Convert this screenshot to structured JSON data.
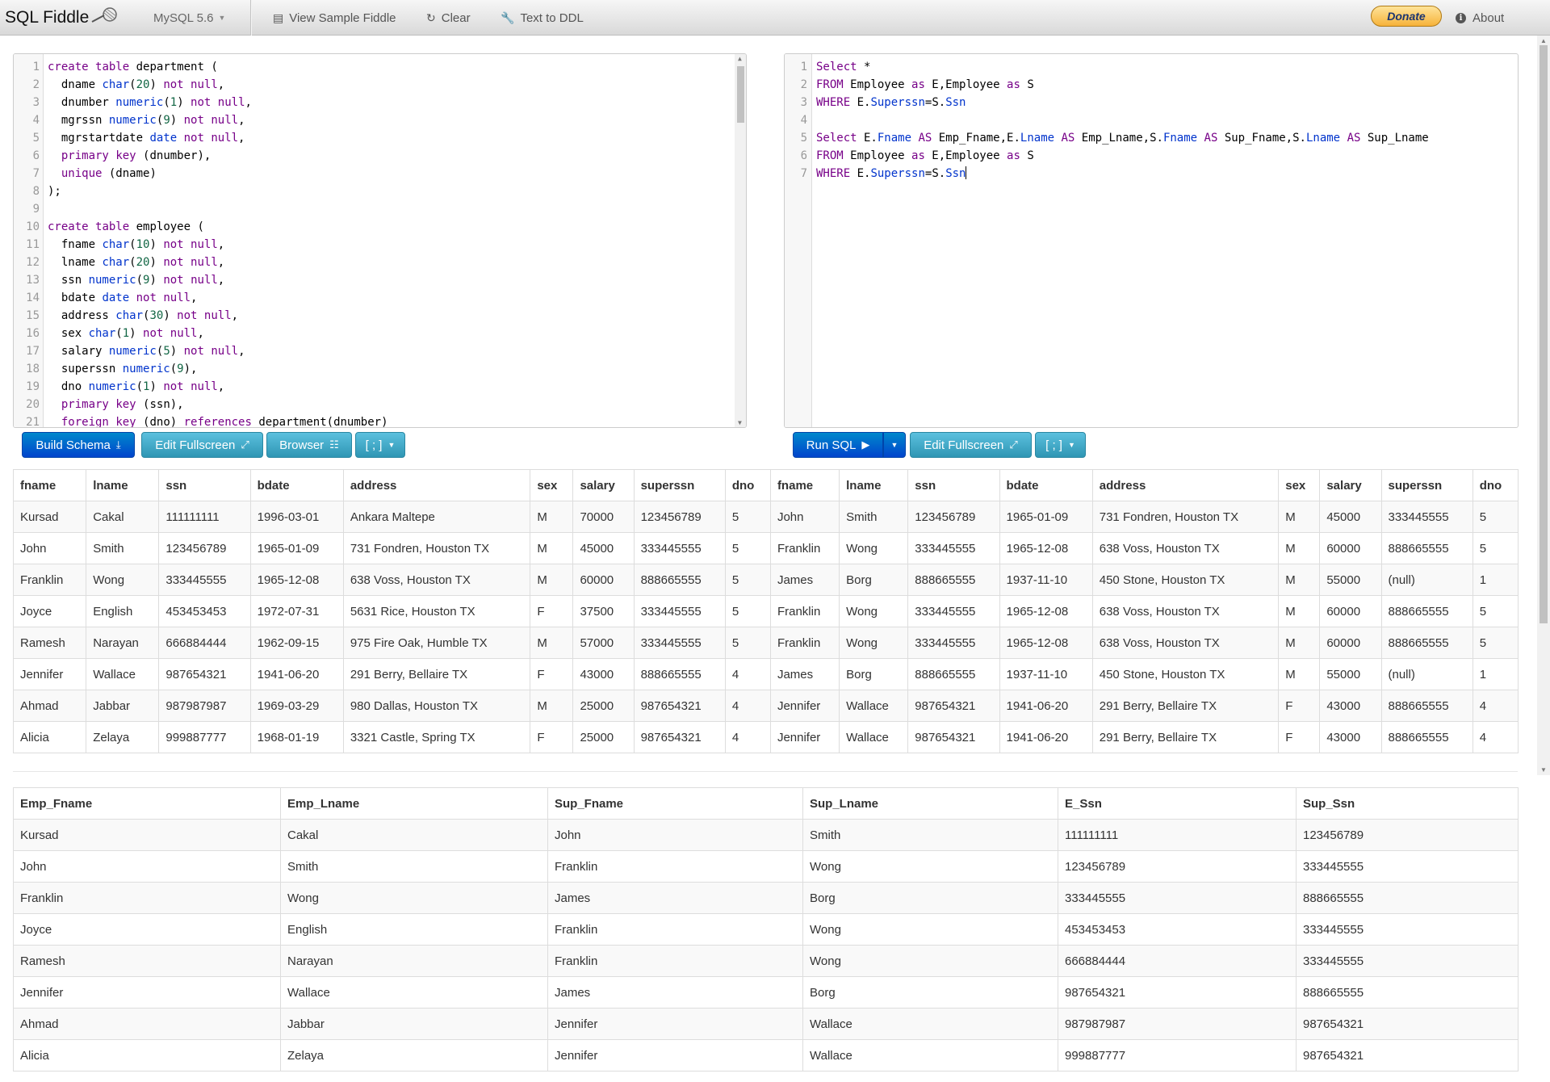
{
  "navbar": {
    "brand": "SQL Fiddle",
    "db_version": "MySQL 5.6",
    "view_sample": "View Sample Fiddle",
    "clear": "Clear",
    "text_to_ddl": "Text to DDL",
    "donate": "Donate",
    "about": "About"
  },
  "schema_panel": {
    "build_label": "Build Schema",
    "edit_fullscreen_label": "Edit Fullscreen",
    "browser_label": "Browser",
    "terminator_label": "[ ; ]"
  },
  "query_panel": {
    "run_label": "Run SQL",
    "edit_fullscreen_label": "Edit Fullscreen",
    "terminator_label": "[ ; ]"
  },
  "schema_code": [
    "create table department (",
    "  dname char(20) not null,",
    "  dnumber numeric(1) not null,",
    "  mgrssn numeric(9) not null,",
    "  mgrstartdate date not null,",
    "  primary key (dnumber),",
    "  unique (dname)",
    ");",
    "",
    "create table employee (",
    "  fname char(10) not null,",
    "  lname char(20) not null,",
    "  ssn numeric(9) not null,",
    "  bdate date not null,",
    "  address char(30) not null,",
    "  sex char(1) not null,",
    "  salary numeric(5) not null,",
    "  superssn numeric(9),",
    "  dno numeric(1) not null,",
    "  primary key (ssn),",
    "  foreign key (dno) references department(dnumber)"
  ],
  "query_code": [
    "Select *",
    "FROM Employee as E,Employee as S",
    "WHERE E.Superssn=S.Ssn",
    "",
    "Select E.Fname AS Emp_Fname,E.Lname AS Emp_Lname,S.Fname AS Sup_Fname,S.Lname AS Sup_Lname",
    "FROM Employee as E,Employee as S",
    "WHERE E.Superssn=S.Ssn"
  ],
  "result1": {
    "columns": [
      "fname",
      "lname",
      "ssn",
      "bdate",
      "address",
      "sex",
      "salary",
      "superssn",
      "dno",
      "fname",
      "lname",
      "ssn",
      "bdate",
      "address",
      "sex",
      "salary",
      "superssn",
      "dno"
    ],
    "rows": [
      [
        "Kursad",
        "Cakal",
        "111111111",
        "1996-03-01",
        "Ankara Maltepe",
        "M",
        "70000",
        "123456789",
        "5",
        "John",
        "Smith",
        "123456789",
        "1965-01-09",
        "731 Fondren, Houston TX",
        "M",
        "45000",
        "333445555",
        "5"
      ],
      [
        "John",
        "Smith",
        "123456789",
        "1965-01-09",
        "731 Fondren, Houston TX",
        "M",
        "45000",
        "333445555",
        "5",
        "Franklin",
        "Wong",
        "333445555",
        "1965-12-08",
        "638 Voss, Houston TX",
        "M",
        "60000",
        "888665555",
        "5"
      ],
      [
        "Franklin",
        "Wong",
        "333445555",
        "1965-12-08",
        "638 Voss, Houston TX",
        "M",
        "60000",
        "888665555",
        "5",
        "James",
        "Borg",
        "888665555",
        "1937-11-10",
        "450 Stone, Houston TX",
        "M",
        "55000",
        "(null)",
        "1"
      ],
      [
        "Joyce",
        "English",
        "453453453",
        "1972-07-31",
        "5631 Rice, Houston TX",
        "F",
        "37500",
        "333445555",
        "5",
        "Franklin",
        "Wong",
        "333445555",
        "1965-12-08",
        "638 Voss, Houston TX",
        "M",
        "60000",
        "888665555",
        "5"
      ],
      [
        "Ramesh",
        "Narayan",
        "666884444",
        "1962-09-15",
        "975 Fire Oak, Humble TX",
        "M",
        "57000",
        "333445555",
        "5",
        "Franklin",
        "Wong",
        "333445555",
        "1965-12-08",
        "638 Voss, Houston TX",
        "M",
        "60000",
        "888665555",
        "5"
      ],
      [
        "Jennifer",
        "Wallace",
        "987654321",
        "1941-06-20",
        "291 Berry, Bellaire TX",
        "F",
        "43000",
        "888665555",
        "4",
        "James",
        "Borg",
        "888665555",
        "1937-11-10",
        "450 Stone, Houston TX",
        "M",
        "55000",
        "(null)",
        "1"
      ],
      [
        "Ahmad",
        "Jabbar",
        "987987987",
        "1969-03-29",
        "980 Dallas, Houston TX",
        "M",
        "25000",
        "987654321",
        "4",
        "Jennifer",
        "Wallace",
        "987654321",
        "1941-06-20",
        "291 Berry, Bellaire TX",
        "F",
        "43000",
        "888665555",
        "4"
      ],
      [
        "Alicia",
        "Zelaya",
        "999887777",
        "1968-01-19",
        "3321 Castle, Spring TX",
        "F",
        "25000",
        "987654321",
        "4",
        "Jennifer",
        "Wallace",
        "987654321",
        "1941-06-20",
        "291 Berry, Bellaire TX",
        "F",
        "43000",
        "888665555",
        "4"
      ]
    ]
  },
  "result2": {
    "columns": [
      "Emp_Fname",
      "Emp_Lname",
      "Sup_Fname",
      "Sup_Lname",
      "E_Ssn",
      "Sup_Ssn"
    ],
    "rows": [
      [
        "Kursad",
        "Cakal",
        "John",
        "Smith",
        "111111111",
        "123456789"
      ],
      [
        "John",
        "Smith",
        "Franklin",
        "Wong",
        "123456789",
        "333445555"
      ],
      [
        "Franklin",
        "Wong",
        "James",
        "Borg",
        "333445555",
        "888665555"
      ],
      [
        "Joyce",
        "English",
        "Franklin",
        "Wong",
        "453453453",
        "333445555"
      ],
      [
        "Ramesh",
        "Narayan",
        "Franklin",
        "Wong",
        "666884444",
        "333445555"
      ],
      [
        "Jennifer",
        "Wallace",
        "James",
        "Borg",
        "987654321",
        "888665555"
      ],
      [
        "Ahmad",
        "Jabbar",
        "Jennifer",
        "Wallace",
        "987987987",
        "987654321"
      ],
      [
        "Alicia",
        "Zelaya",
        "Jennifer",
        "Wallace",
        "999887777",
        "987654321"
      ]
    ]
  },
  "colors": {
    "primary_button": "#0055cc",
    "info_button": "#3aa3c4",
    "sql_keyword": "#770088",
    "sql_type": "#0033cc"
  }
}
